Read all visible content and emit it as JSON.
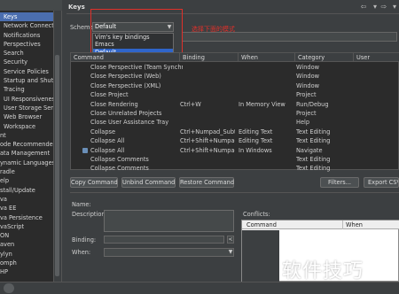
{
  "header": {
    "title": "Keys"
  },
  "tree": {
    "items": [
      {
        "label": "Keys",
        "selected": true,
        "top": false
      },
      {
        "label": "Network Connections",
        "selected": false,
        "top": false
      },
      {
        "label": "Notifications",
        "selected": false,
        "top": false
      },
      {
        "label": "Perspectives",
        "selected": false,
        "top": false
      },
      {
        "label": "Search",
        "selected": false,
        "top": false
      },
      {
        "label": "Security",
        "selected": false,
        "top": false
      },
      {
        "label": "Service Policies",
        "selected": false,
        "top": false
      },
      {
        "label": "Startup and Shutdown",
        "selected": false,
        "top": false
      },
      {
        "label": "Tracing",
        "selected": false,
        "top": false
      },
      {
        "label": "UI Responsiveness",
        "selected": false,
        "top": false
      },
      {
        "label": "User Storage Service",
        "selected": false,
        "top": false
      },
      {
        "label": "Web Browser",
        "selected": false,
        "top": false
      },
      {
        "label": "Workspace",
        "selected": false,
        "top": false
      },
      {
        "label": "nt",
        "selected": false,
        "top": true
      },
      {
        "label": "ode Recommenders",
        "selected": false,
        "top": true
      },
      {
        "label": "ata Management",
        "selected": false,
        "top": true
      },
      {
        "label": "ynamic Languages",
        "selected": false,
        "top": true
      },
      {
        "label": "radle",
        "selected": false,
        "top": true
      },
      {
        "label": "elp",
        "selected": false,
        "top": true
      },
      {
        "label": "stall/Update",
        "selected": false,
        "top": true
      },
      {
        "label": "va",
        "selected": false,
        "top": true
      },
      {
        "label": "va EE",
        "selected": false,
        "top": true
      },
      {
        "label": "va Persistence",
        "selected": false,
        "top": true
      },
      {
        "label": "vaScript",
        "selected": false,
        "top": true
      },
      {
        "label": "ON",
        "selected": false,
        "top": true
      },
      {
        "label": "aven",
        "selected": false,
        "top": true
      },
      {
        "label": "ylyn",
        "selected": false,
        "top": true
      },
      {
        "label": "omph",
        "selected": false,
        "top": true
      },
      {
        "label": "HP",
        "selected": false,
        "top": true
      }
    ]
  },
  "scheme": {
    "label": "Scheme:",
    "selected": "Default",
    "options": [
      {
        "label": "Vim's key bindings",
        "selected": false
      },
      {
        "label": "Emacs",
        "selected": false
      },
      {
        "label": "Default",
        "selected": true
      }
    ],
    "annotation": "选择下面的模式"
  },
  "table": {
    "headers": {
      "command": "Command",
      "binding": "Binding",
      "when": "When",
      "category": "Category",
      "user": "User"
    },
    "rows": [
      {
        "command": "Close Perspective (Team Synchronizing)",
        "binding": "",
        "when": "",
        "category": "Window",
        "icon": false
      },
      {
        "command": "Close Perspective (Web)",
        "binding": "",
        "when": "",
        "category": "Window",
        "icon": false
      },
      {
        "command": "Close Perspective (XML)",
        "binding": "",
        "when": "",
        "category": "Window",
        "icon": false
      },
      {
        "command": "Close Project",
        "binding": "",
        "when": "",
        "category": "Project",
        "icon": false
      },
      {
        "command": "Close Rendering",
        "binding": "Ctrl+W",
        "when": "In Memory View",
        "category": "Run/Debug",
        "icon": false
      },
      {
        "command": "Close Unrelated Projects",
        "binding": "",
        "when": "",
        "category": "Project",
        "icon": false
      },
      {
        "command": "Close User Assistance Tray",
        "binding": "",
        "when": "",
        "category": "Help",
        "icon": false
      },
      {
        "command": "Collapse",
        "binding": "Ctrl+Numpad_Subtract",
        "when": "Editing Text",
        "category": "Text Editing",
        "icon": false
      },
      {
        "command": "Collapse All",
        "binding": "Ctrl+Shift+Numpad_Divide",
        "when": "Editing Text",
        "category": "Text Editing",
        "icon": false
      },
      {
        "command": "Collapse All",
        "binding": "Ctrl+Shift+Numpad_Divide",
        "when": "In Windows",
        "category": "Navigate",
        "icon": true
      },
      {
        "command": "Collapse Comments",
        "binding": "",
        "when": "",
        "category": "Text Editing",
        "icon": false
      },
      {
        "command": "Collapse Comments",
        "binding": "",
        "when": "",
        "category": "Text Editing",
        "icon": false
      }
    ]
  },
  "buttons": {
    "copy": "Copy Command",
    "unbind": "Unbind Command",
    "restore": "Restore Command",
    "filters": "Filters...",
    "export": "Export CSV..."
  },
  "details": {
    "name_label": "Name:",
    "description_label": "Description:",
    "binding_label": "Binding:",
    "when_label": "When:",
    "conflicts_label": "Conflicts:",
    "conflicts_headers": {
      "command": "Command",
      "when": "When"
    }
  },
  "watermark": "软件技巧"
}
